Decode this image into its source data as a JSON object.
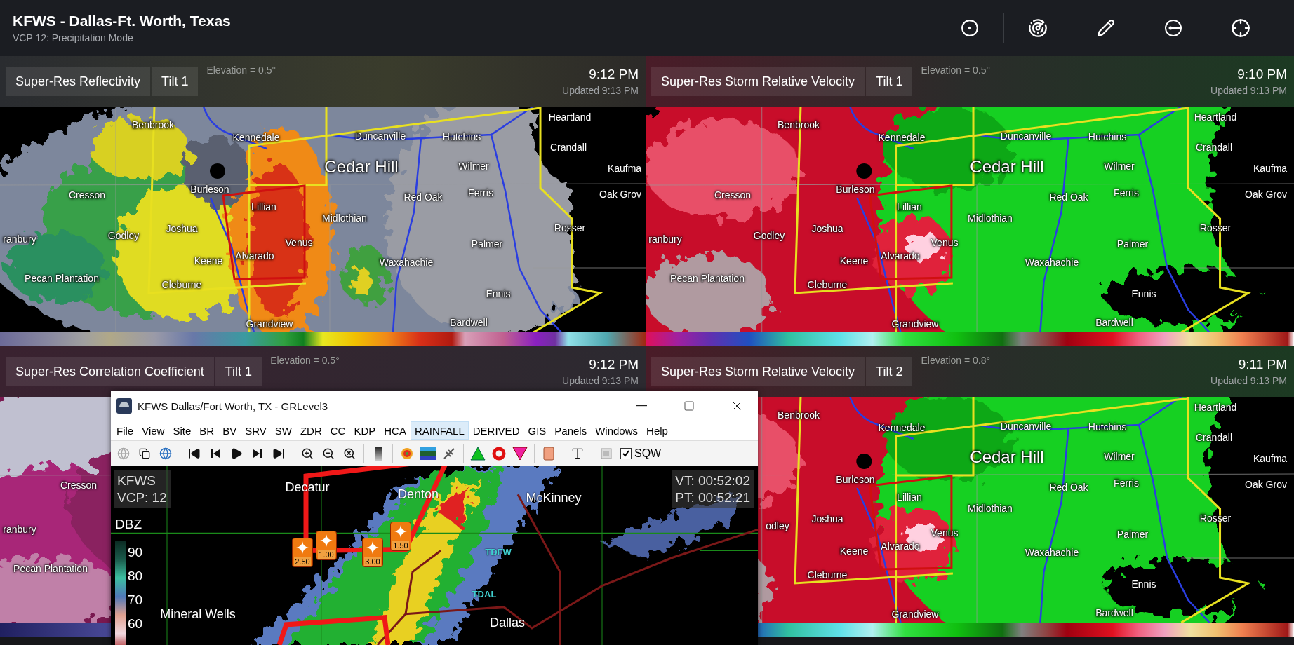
{
  "header": {
    "title": "KFWS - Dallas-Ft. Worth, Texas",
    "subtitle": "VCP 12: Precipitation Mode"
  },
  "panels": [
    {
      "kind": "reflectivity",
      "product": "Super-Res Reflectivity",
      "tilt": "Tilt 1",
      "elevation": "Elevation = 0.5°",
      "time": "9:12 PM",
      "updated": "Updated 9:13 PM",
      "labels": [
        {
          "name": "Benbrook",
          "kind": "town"
        },
        {
          "name": "Kennedale",
          "kind": "town"
        },
        {
          "name": "Duncanville",
          "kind": "town"
        },
        {
          "name": "Hutchins",
          "kind": "town"
        },
        {
          "name": "Heartland",
          "kind": "town"
        },
        {
          "name": "Crandall",
          "kind": "town"
        },
        {
          "name": "Cedar Hill",
          "kind": "major"
        },
        {
          "name": "Wilmer",
          "kind": "town"
        },
        {
          "name": "Kaufma",
          "kind": "town"
        },
        {
          "name": "Cresson",
          "kind": "town"
        },
        {
          "name": "Burleson",
          "kind": "town"
        },
        {
          "name": "Red Oak",
          "kind": "town"
        },
        {
          "name": "Ferris",
          "kind": "town"
        },
        {
          "name": "Oak Grov",
          "kind": "town"
        },
        {
          "name": "Lillian",
          "kind": "town"
        },
        {
          "name": "Midlothian",
          "kind": "town"
        },
        {
          "name": "ranbury",
          "kind": "town"
        },
        {
          "name": "Godley",
          "kind": "town"
        },
        {
          "name": "Joshua",
          "kind": "town"
        },
        {
          "name": "Venus",
          "kind": "town"
        },
        {
          "name": "Rosser",
          "kind": "town"
        },
        {
          "name": "Palmer",
          "kind": "town"
        },
        {
          "name": "Keene",
          "kind": "town"
        },
        {
          "name": "Alvarado",
          "kind": "town"
        },
        {
          "name": "Waxahachie",
          "kind": "town"
        },
        {
          "name": "Pecan Plantation",
          "kind": "town"
        },
        {
          "name": "Cleburne",
          "kind": "town"
        },
        {
          "name": "Ennis",
          "kind": "town"
        },
        {
          "name": "Grandview",
          "kind": "town"
        },
        {
          "name": "Bardwell",
          "kind": "town"
        }
      ]
    },
    {
      "kind": "velocity",
      "product": "Super-Res Storm Relative Velocity",
      "tilt": "Tilt 1",
      "elevation": "Elevation = 0.5°",
      "time": "9:10 PM",
      "updated": "Updated 9:13 PM",
      "labels": [
        {
          "name": "Benbrook",
          "kind": "town"
        },
        {
          "name": "Kennedale",
          "kind": "town"
        },
        {
          "name": "Duncanville",
          "kind": "town"
        },
        {
          "name": "Hutchins",
          "kind": "town"
        },
        {
          "name": "Heartland",
          "kind": "town"
        },
        {
          "name": "Crandall",
          "kind": "town"
        },
        {
          "name": "Cedar Hill",
          "kind": "major"
        },
        {
          "name": "Wilmer",
          "kind": "town"
        },
        {
          "name": "Kaufma",
          "kind": "town"
        },
        {
          "name": "Cresson",
          "kind": "town"
        },
        {
          "name": "Burleson",
          "kind": "town"
        },
        {
          "name": "Red Oak",
          "kind": "town"
        },
        {
          "name": "Ferris",
          "kind": "town"
        },
        {
          "name": "Oak Grov",
          "kind": "town"
        },
        {
          "name": "Lillian",
          "kind": "town"
        },
        {
          "name": "Midlothian",
          "kind": "town"
        },
        {
          "name": "ranbury",
          "kind": "town"
        },
        {
          "name": "Godley",
          "kind": "town"
        },
        {
          "name": "Joshua",
          "kind": "town"
        },
        {
          "name": "Venus",
          "kind": "town"
        },
        {
          "name": "Rosser",
          "kind": "town"
        },
        {
          "name": "Palmer",
          "kind": "town"
        },
        {
          "name": "Keene",
          "kind": "town"
        },
        {
          "name": "Alvarado",
          "kind": "town"
        },
        {
          "name": "Waxahachie",
          "kind": "town"
        },
        {
          "name": "Pecan Plantation",
          "kind": "town"
        },
        {
          "name": "Cleburne",
          "kind": "town"
        },
        {
          "name": "Ennis",
          "kind": "town"
        },
        {
          "name": "Grandview",
          "kind": "town"
        },
        {
          "name": "Bardwell",
          "kind": "town"
        }
      ]
    },
    {
      "kind": "correlation",
      "product": "Super-Res Correlation Coefficient",
      "tilt": "Tilt 1",
      "elevation": "Elevation = 0.5°",
      "time": "9:12 PM",
      "updated": "Updated 9:13 PM",
      "labels": [
        {
          "name": "Cresson",
          "kind": "town"
        },
        {
          "name": "ranbury",
          "kind": "town"
        },
        {
          "name": "Pecan Plantation",
          "kind": "town"
        }
      ]
    },
    {
      "kind": "velocity",
      "product": "Super-Res Storm Relative Velocity",
      "tilt": "Tilt 2",
      "elevation": "Elevation = 0.8°",
      "time": "9:11 PM",
      "updated": "Updated 9:13 PM",
      "labels": [
        {
          "name": "Benbrook",
          "kind": "town"
        },
        {
          "name": "Kennedale",
          "kind": "town"
        },
        {
          "name": "Duncanville",
          "kind": "town"
        },
        {
          "name": "Hutchins",
          "kind": "town"
        },
        {
          "name": "Heartland",
          "kind": "town"
        },
        {
          "name": "Crandall",
          "kind": "town"
        },
        {
          "name": "Cedar Hill",
          "kind": "major"
        },
        {
          "name": "Wilmer",
          "kind": "town"
        },
        {
          "name": "Kaufma",
          "kind": "town"
        },
        {
          "name": "Burleson",
          "kind": "town"
        },
        {
          "name": "Red Oak",
          "kind": "town"
        },
        {
          "name": "Ferris",
          "kind": "town"
        },
        {
          "name": "Oak Grov",
          "kind": "town"
        },
        {
          "name": "Lillian",
          "kind": "town"
        },
        {
          "name": "Midlothian",
          "kind": "town"
        },
        {
          "name": "odley",
          "kind": "town"
        },
        {
          "name": "Joshua",
          "kind": "town"
        },
        {
          "name": "Venus",
          "kind": "town"
        },
        {
          "name": "Rosser",
          "kind": "town"
        },
        {
          "name": "Palmer",
          "kind": "town"
        },
        {
          "name": "Keene",
          "kind": "town"
        },
        {
          "name": "Alvarado",
          "kind": "town"
        },
        {
          "name": "Waxahachie",
          "kind": "town"
        },
        {
          "name": "Cleburne",
          "kind": "town"
        },
        {
          "name": "Ennis",
          "kind": "town"
        },
        {
          "name": "Grandview",
          "kind": "town"
        },
        {
          "name": "Bardwell",
          "kind": "town"
        }
      ]
    }
  ],
  "grlevel3": {
    "title": "KFWS Dallas/Fort Worth, TX - GRLevel3",
    "menu": [
      {
        "label": "File",
        "selected": false
      },
      {
        "label": "View",
        "selected": false
      },
      {
        "label": "Site",
        "selected": false
      },
      {
        "label": "BR",
        "selected": false
      },
      {
        "label": "BV",
        "selected": false
      },
      {
        "label": "SRV",
        "selected": false
      },
      {
        "label": "SW",
        "selected": false
      },
      {
        "label": "ZDR",
        "selected": false
      },
      {
        "label": "CC",
        "selected": false
      },
      {
        "label": "KDP",
        "selected": false
      },
      {
        "label": "HCA",
        "selected": false
      },
      {
        "label": "RAINFALL",
        "selected": true
      },
      {
        "label": "DERIVED",
        "selected": false
      },
      {
        "label": "GIS",
        "selected": false
      },
      {
        "label": "Panels",
        "selected": false
      },
      {
        "label": "Windows",
        "selected": false
      },
      {
        "label": "Help",
        "selected": false
      }
    ],
    "sqw": {
      "label": "SQW",
      "checked": true
    },
    "site_info": [
      "KFWS",
      "VCP: 12"
    ],
    "times": [
      "VT: 00:52:02",
      "PT: 00:52:21"
    ],
    "legend": {
      "title": "DBZ",
      "ticks": [
        "90",
        "80",
        "70",
        "60"
      ]
    },
    "places": [
      {
        "name": "Decatur",
        "kind": "city"
      },
      {
        "name": "Denton",
        "kind": "city"
      },
      {
        "name": "McKinney",
        "kind": "city"
      },
      {
        "name": "TDFW",
        "kind": "station"
      },
      {
        "name": "TDAL",
        "kind": "station"
      },
      {
        "name": "Dallas",
        "kind": "city"
      },
      {
        "name": "Mineral Wells",
        "kind": "city"
      }
    ],
    "badges": [
      "2.50",
      "1.00",
      "3.00",
      "1.50"
    ]
  }
}
